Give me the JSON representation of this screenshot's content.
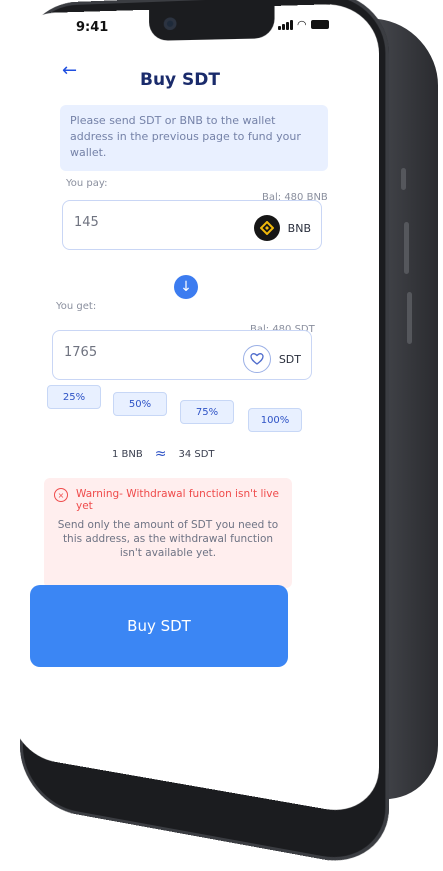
{
  "status_bar": {
    "time": "9:41"
  },
  "header": {
    "title": "Buy SDT",
    "back_icon": "arrow-left-icon"
  },
  "info_banner": {
    "text": "Please send SDT or BNB to the wallet address in the previous page to fund your wallet."
  },
  "pay": {
    "label": "You pay:",
    "balance": "Bal: 480 BNB",
    "amount": "145",
    "token": "BNB"
  },
  "get": {
    "label": "You get:",
    "balance": "Bal: 480 SDT",
    "amount": "1765",
    "token": "SDT"
  },
  "percent_buttons": [
    "25%",
    "50%",
    "75%",
    "100%"
  ],
  "rate": {
    "left": "1 BNB",
    "approx": "≈",
    "right": "34 SDT"
  },
  "warning": {
    "title": "Warning- Withdrawal function isn't live yet",
    "body": "Send only the amount of SDT you need to this address, as the withdrawal function isn't available yet."
  },
  "buy_button": {
    "label": "Buy SDT"
  },
  "colors": {
    "primary": "#3b86f4",
    "warning": "#ef4b4b",
    "heading": "#1a2b6b"
  }
}
